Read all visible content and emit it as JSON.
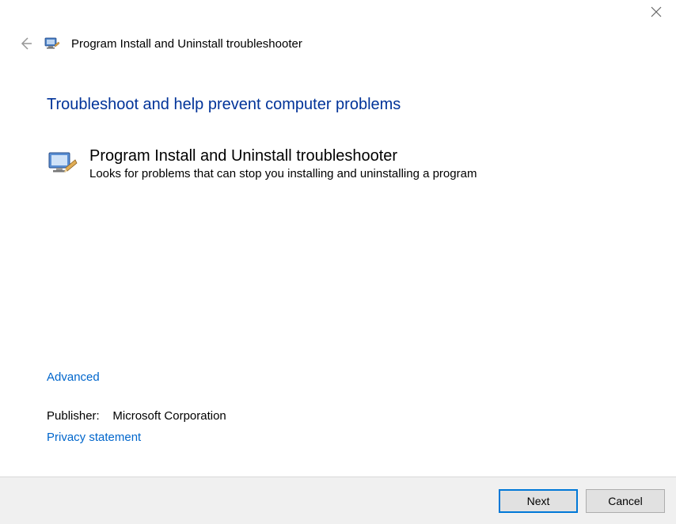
{
  "window": {
    "title": "Program Install and Uninstall troubleshooter"
  },
  "main": {
    "heading": "Troubleshoot and help prevent computer problems",
    "troubleshooter": {
      "name": "Program Install and Uninstall troubleshooter",
      "description": "Looks for problems that can stop you installing and uninstalling a program"
    }
  },
  "links": {
    "advanced": "Advanced",
    "publisher_label": "Publisher:",
    "publisher_value": "Microsoft Corporation",
    "privacy": "Privacy statement"
  },
  "buttons": {
    "next": "Next",
    "cancel": "Cancel"
  }
}
